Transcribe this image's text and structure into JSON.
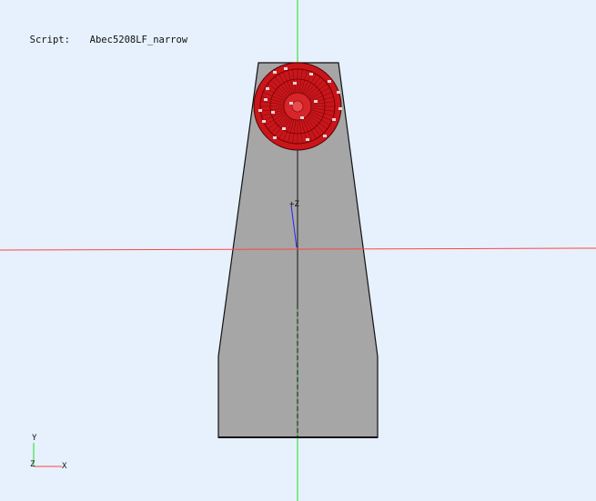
{
  "script": {
    "label": "Script:",
    "name": "Abec5208LF_narrow"
  },
  "axes": {
    "z_marker": "+Z",
    "triad": {
      "y_label": "Y",
      "z_label": "Z",
      "x_label": "X"
    }
  },
  "colors": {
    "background": "#e6f1fd",
    "cabinet": "#a6a6a6",
    "driver": "#c8161b",
    "x_axis": "#ff4444",
    "y_axis": "#22dd22",
    "z_axis": "#2222ff"
  }
}
